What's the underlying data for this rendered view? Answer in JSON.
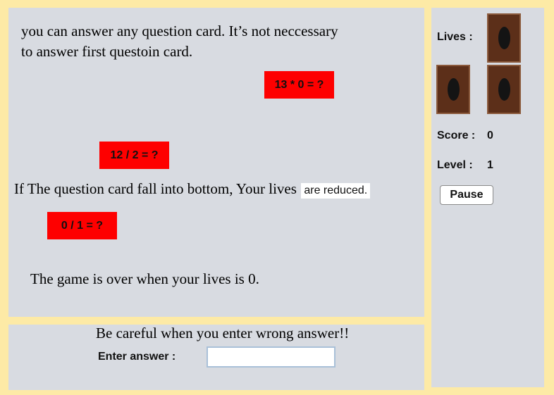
{
  "game_area": {
    "tips": [
      "you can answer any question card. It’s not neccessary",
      "to answer first questoin card."
    ],
    "tip_fall_prefix": "If The question card fall into bottom, Your lives",
    "tip_fall_suffix": "are reduced.",
    "tip_game_over": "The game is over when your lives is 0.",
    "cards": [
      "13 * 0 = ?",
      "12 / 2 = ?",
      "0 / 1 = ?"
    ]
  },
  "answer_area": {
    "warning": "Be careful when you enter wrong answer!!",
    "label": "Enter answer :",
    "value": ""
  },
  "side_panel": {
    "lives_label": "Lives :",
    "lives": 3,
    "score_label": "Score :",
    "score": "0",
    "level_label": "Level :",
    "level": "1",
    "pause_label": "Pause"
  },
  "colors": {
    "page_border": "#fdeaa6",
    "panel_bg": "#d8dbe1",
    "card_bg": "#fe0000",
    "life_card": "#5c2f19"
  },
  "icons": {
    "life": "life-card-icon"
  }
}
